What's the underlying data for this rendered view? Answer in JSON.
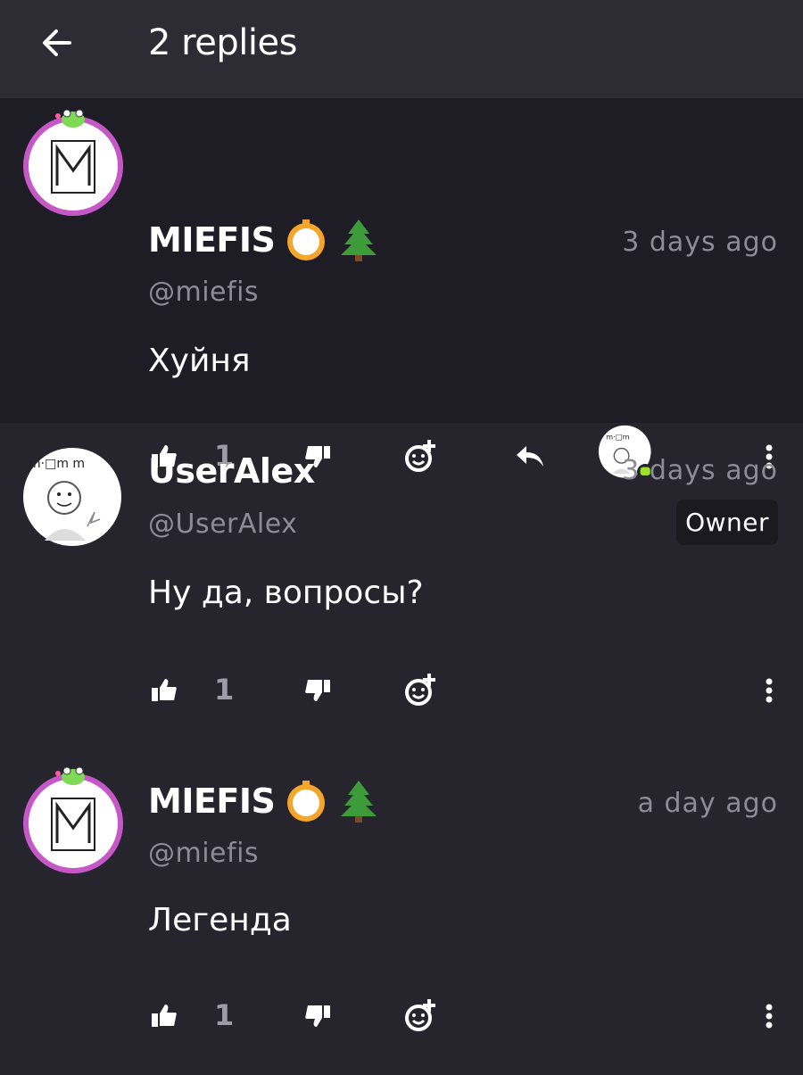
{
  "header": {
    "title": "2 replies",
    "back_icon": "arrow-left-icon"
  },
  "comments": [
    {
      "username": "MIEFIS",
      "handle": "@miefis",
      "time": "3 days ago",
      "text": "Хуйня",
      "likes": "1",
      "highlighted": true,
      "badges": [
        "compass-icon",
        "tree-icon"
      ]
    },
    {
      "username": "UserAlex",
      "handle": "@UserAlex",
      "time": "3 days ago",
      "text": "Ну да, вопросы?",
      "likes": "1",
      "role": "Owner"
    },
    {
      "username": "MIEFIS",
      "handle": "@miefis",
      "time": "a day ago",
      "text": "Легенда",
      "likes": "1",
      "badges": [
        "compass-icon",
        "tree-icon"
      ]
    }
  ],
  "colors": {
    "background": "#26252e",
    "highlight": "#1e1d25",
    "topbar": "#2d2c35",
    "muted": "#8d8b96",
    "avatar_ring": "#c657c7",
    "online": "#9be22d"
  }
}
